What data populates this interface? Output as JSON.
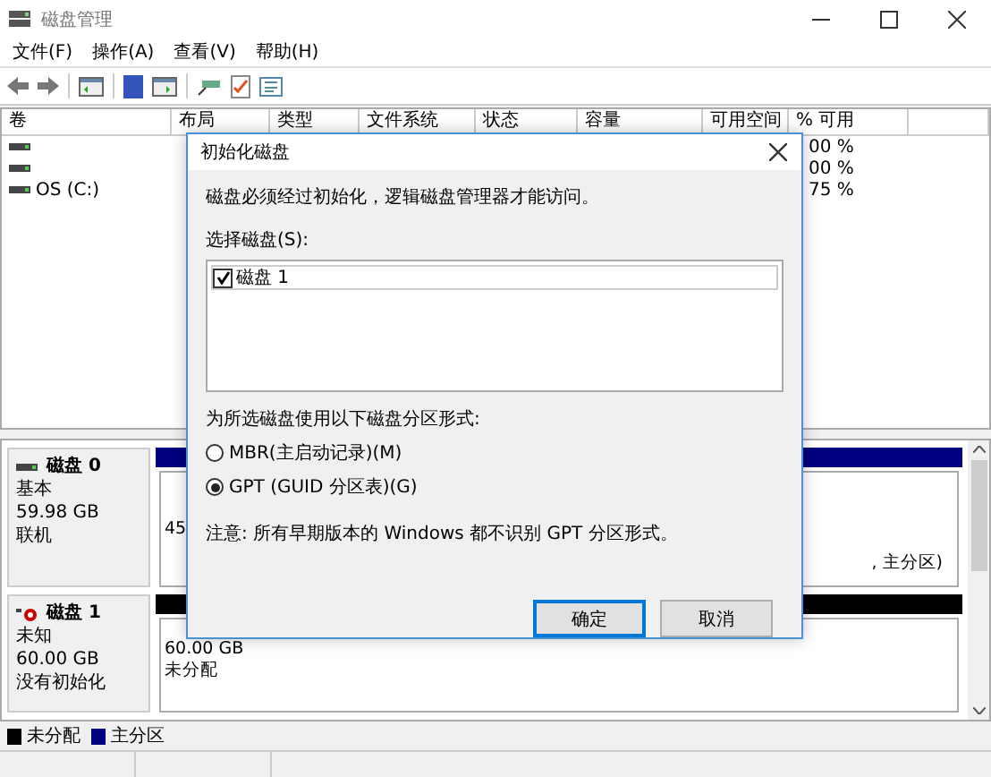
{
  "window": {
    "title": "磁盘管理"
  },
  "menu": [
    "文件(F)",
    "操作(A)",
    "查看(V)",
    "帮助(H)"
  ],
  "table": {
    "columns": [
      "卷",
      "布局",
      "类型",
      "文件系统",
      "状态",
      "容量",
      "可用空间",
      "% 可用"
    ],
    "rows": [
      {
        "free_percent": "00 %"
      },
      {
        "free_percent": "00 %"
      },
      {
        "name": "OS (C:)",
        "free_percent": "75 %"
      }
    ]
  },
  "disks": [
    {
      "kind": "basic",
      "name": "磁盘 0",
      "type": "基本",
      "size": "59.98 GB",
      "status": "联机",
      "color": "#000080",
      "partition_texts": [
        "45"
      ],
      "partition_tail": ", 主分区)"
    },
    {
      "kind": "uninitialized",
      "name": "磁盘 1",
      "type": "未知",
      "size": "60.00 GB",
      "status": "没有初始化",
      "color": "#000000",
      "partition_texts": [
        "60.00 GB",
        "未分配"
      ]
    }
  ],
  "legend": [
    {
      "label": "未分配",
      "color": "#000000"
    },
    {
      "label": "主分区",
      "color": "#000080"
    }
  ],
  "dialog": {
    "title": "初始化磁盘",
    "message": "磁盘必须经过初始化，逻辑磁盘管理器才能访问。",
    "list_label": "选择磁盘(S):",
    "disks": [
      {
        "label": "磁盘 1",
        "checked": true
      }
    ],
    "style_label": "为所选磁盘使用以下磁盘分区形式:",
    "options": [
      {
        "label": "MBR(主启动记录)(M)",
        "selected": false
      },
      {
        "label": "GPT (GUID 分区表)(G)",
        "selected": true
      }
    ],
    "note": "注意: 所有早期版本的 Windows 都不识别 GPT 分区形式。",
    "buttons": [
      {
        "label": "确定",
        "default": true
      },
      {
        "label": "取消",
        "default": false
      }
    ]
  }
}
